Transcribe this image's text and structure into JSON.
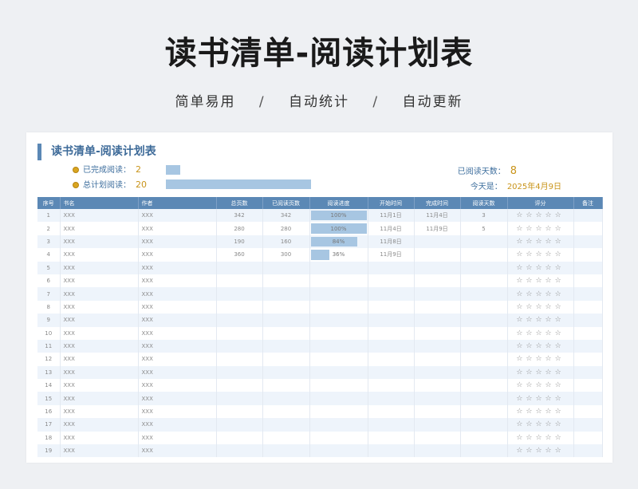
{
  "page": {
    "title": "读书清单-阅读计划表",
    "subtitle": [
      "简单易用",
      "自动统计",
      "自动更新"
    ],
    "subtitle_sep": "/"
  },
  "sheet": {
    "title": "读书清单-阅读计划表",
    "completed_label": "已完成阅读：",
    "completed_value": "2",
    "completed_fraction": 0.1,
    "planned_label": "总计划阅读：",
    "planned_value": "20",
    "planned_fraction": 1.0,
    "days_label": "已阅读天数：",
    "days_value": "8",
    "today_label": "今天是：",
    "today_value": "2025年4月9日"
  },
  "table": {
    "headers": [
      "序号",
      "书名",
      "作者",
      "总页数",
      "已阅读页数",
      "阅读进度",
      "开始时间",
      "完成时间",
      "阅读天数",
      "评分",
      "备注"
    ],
    "rows": [
      {
        "no": "1",
        "book": "XXX",
        "author": "XXX",
        "total": "342",
        "read": "342",
        "progress": 1.0,
        "progress_text": "100%",
        "start": "11月1日",
        "end": "11月4日",
        "days": "3"
      },
      {
        "no": "2",
        "book": "XXX",
        "author": "XXX",
        "total": "280",
        "read": "280",
        "progress": 1.0,
        "progress_text": "100%",
        "start": "11月4日",
        "end": "11月9日",
        "days": "5"
      },
      {
        "no": "3",
        "book": "XXX",
        "author": "XXX",
        "total": "190",
        "read": "160",
        "progress": 0.84,
        "progress_text": "84%",
        "start": "11月8日",
        "end": "",
        "days": ""
      },
      {
        "no": "4",
        "book": "XXX",
        "author": "XXX",
        "total": "360",
        "read": "300",
        "progress": 0.36,
        "progress_text": "36%",
        "start": "11月9日",
        "end": "",
        "days": ""
      },
      {
        "no": "5",
        "book": "XXX",
        "author": "XXX"
      },
      {
        "no": "6",
        "book": "XXX",
        "author": "XXX"
      },
      {
        "no": "7",
        "book": "XXX",
        "author": "XXX"
      },
      {
        "no": "8",
        "book": "XXX",
        "author": "XXX"
      },
      {
        "no": "9",
        "book": "XXX",
        "author": "XXX"
      },
      {
        "no": "10",
        "book": "XXX",
        "author": "XXX"
      },
      {
        "no": "11",
        "book": "XXX",
        "author": "XXX"
      },
      {
        "no": "12",
        "book": "XXX",
        "author": "XXX"
      },
      {
        "no": "13",
        "book": "XXX",
        "author": "XXX"
      },
      {
        "no": "14",
        "book": "XXX",
        "author": "XXX"
      },
      {
        "no": "15",
        "book": "XXX",
        "author": "XXX"
      },
      {
        "no": "16",
        "book": "XXX",
        "author": "XXX"
      },
      {
        "no": "17",
        "book": "XXX",
        "author": "XXX"
      },
      {
        "no": "18",
        "book": "XXX",
        "author": "XXX"
      },
      {
        "no": "19",
        "book": "XXX",
        "author": "XXX"
      }
    ],
    "stars": "☆☆☆☆☆"
  },
  "colors": {
    "header_bg": "#5b88b5",
    "accent_gold": "#c9941a",
    "progress_fill": "#a7c6e2"
  }
}
